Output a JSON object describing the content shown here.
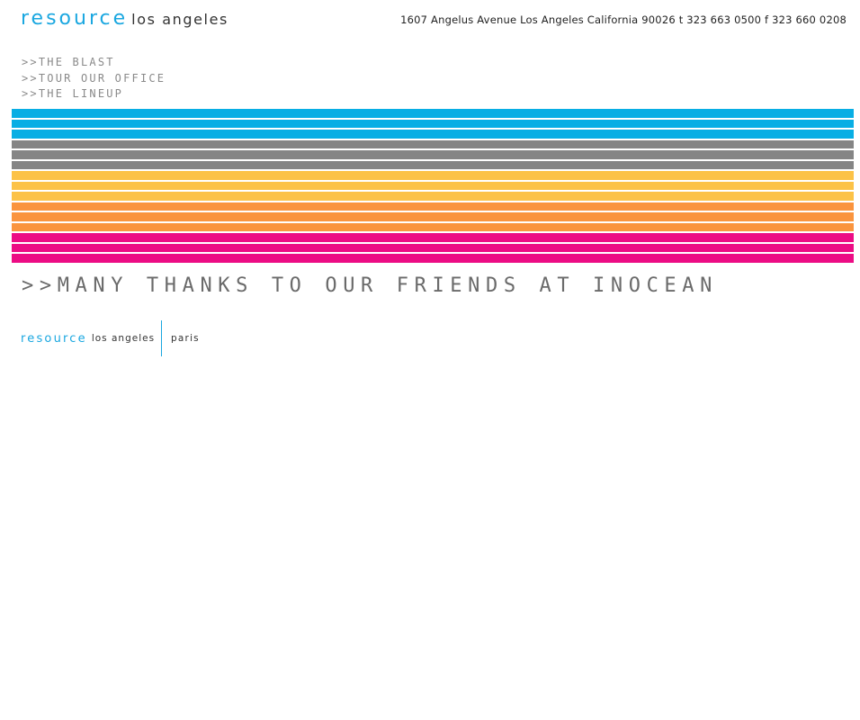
{
  "header": {
    "brand": "resource",
    "city": "los angeles",
    "address": "1607 Angelus Avenue Los Angeles California 90026  t 323 663 0500 f 323 660 0208"
  },
  "nav": {
    "items": [
      ">>THE BLAST",
      ">>TOUR OUR OFFICE",
      ">>THE LINEUP"
    ]
  },
  "stripes": {
    "colors": [
      "#08aee4",
      "#08aee4",
      "#08aee4",
      "#858585",
      "#858585",
      "#858585",
      "#fcc247",
      "#fcc247",
      "#fcc247",
      "#fa943e",
      "#fa943e",
      "#fa943e",
      "#ec0c84",
      "#ec0c84",
      "#ec0c84"
    ]
  },
  "main": {
    "thanks": ">>MANY THANKS TO OUR FRIENDS AT INOCEAN"
  },
  "footer": {
    "brand": "resource",
    "city": "los angeles",
    "paris": "paris"
  },
  "colors": {
    "brand": "#1aa7e0",
    "text": "#333333",
    "nav": "#8a8a8a"
  }
}
